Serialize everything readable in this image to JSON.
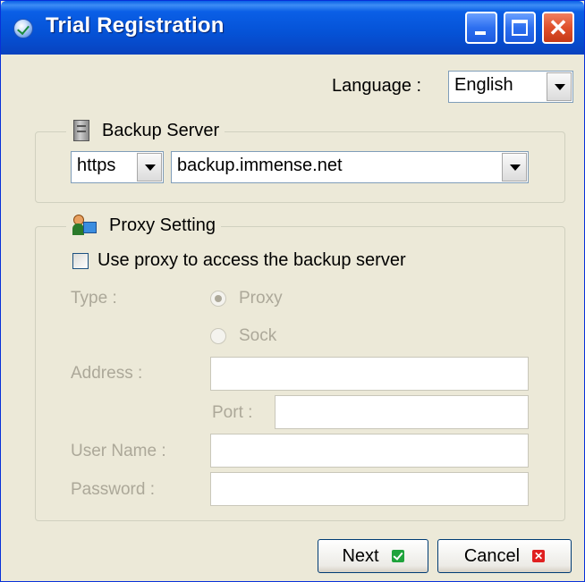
{
  "window": {
    "title": "Trial Registration",
    "close_glyph": "✕"
  },
  "language": {
    "label": "Language :",
    "value": "English"
  },
  "backup_server": {
    "legend": "Backup Server",
    "protocol": "https",
    "host": "backup.immense.net"
  },
  "proxy": {
    "legend": "Proxy Setting",
    "use_proxy_label": "Use proxy to access the backup server",
    "use_proxy_checked": false,
    "type_label": "Type :",
    "type_options": [
      "Proxy",
      "Sock"
    ],
    "type_selected": "Proxy",
    "address_label": "Address :",
    "port_label": "Port :",
    "username_label": "User Name :",
    "password_label": "Password :"
  },
  "buttons": {
    "next": "Next",
    "cancel": "Cancel"
  },
  "colors": {
    "titlebar": "#0552d6",
    "dialog_bg": "#ece9d8",
    "disabled_text": "#aca899"
  }
}
